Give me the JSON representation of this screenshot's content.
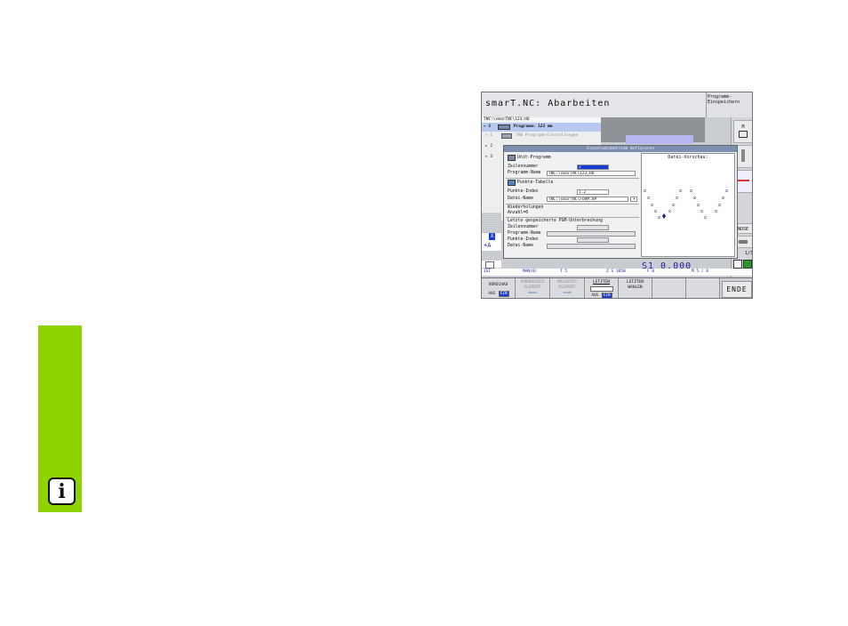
{
  "window": {
    "title": "smarT.NC: Abarbeiten",
    "program_store_label": "Programm-\nEinspeichern",
    "path": "TNC:\\smarTNC\\123.HU"
  },
  "tree": {
    "rows": [
      {
        "prefix": "▾ 0",
        "label": "Programm: 123 mm"
      },
      {
        "prefix": "▸ 1",
        "label": "700 Programm-Einstellungen"
      },
      {
        "prefix": "▸ 2",
        "label": ""
      },
      {
        "prefix": "▸ 3",
        "label": ""
      }
    ]
  },
  "dialog": {
    "title": "Einzelsatzbetrieb definieren",
    "unit_program_header": "Unit-Programm",
    "zeilennummer_label": "Zeilennummer",
    "zeilennummer_value": "2",
    "programm_name_label": "Programm-Name",
    "programm_name_value": "TNC:\\smarTNC\\123.HU",
    "punkte_tabelle_header": "Punkte-Tabelle",
    "punkte_index_label": "Punkte-Index",
    "punkte_index_value": "1.2",
    "datei_name_label": "Datei-Name",
    "datei_name_value": "TNC:\\smarTNC\\FORM.HP",
    "wiederholungen_label": "Wiederholungen",
    "wiederholungen_value": "Anzahl=0",
    "last_saved_header": "Letzte gespeicherte PGM-Unterbrechung",
    "last_zeilennummer_label": "Zeilennummer",
    "last_programm_name_label": "Programm-Name",
    "last_punkte_index_label": "Punkte-Index",
    "last_datei_name_label": "Datei-Name",
    "preview_title": "Datei-Vorschau:"
  },
  "status": {
    "s1_value": "S1   0.000",
    "ist": "IST",
    "mode": "MAN(0)",
    "t_value": "T 5",
    "z_value": "Z S 1050",
    "f_value": "F 0",
    "m_value": "M 5 / 8",
    "page": "1/3"
  },
  "softkeys": [
    {
      "label": "VORSCHAU",
      "sub": [
        "AUS",
        "EIN"
      ],
      "active_sub": 1,
      "dim": false
    },
    {
      "label": "VORHERIGES\nELEMENT",
      "dim": true
    },
    {
      "label": "NACHSTES\nELEMENT",
      "dim": true
    },
    {
      "label": "LETZTEN",
      "sub": [
        "AUS",
        "EIN"
      ],
      "active_sub": 1,
      "dim": false
    },
    {
      "label": "LETZTEN\nWAHLEN",
      "dim": false
    },
    {
      "label": "",
      "dim": false
    },
    {
      "label": "",
      "dim": false
    }
  ],
  "ende_label": "ENDE",
  "right_panel": {
    "nose_label": "NOSE"
  },
  "left_axis": {
    "x_label": "X",
    "a_label": "+A"
  },
  "info_icon_glyph": "i",
  "colors": {
    "sidebar_green": "#8fd400",
    "highlight_blue": "#1a3bd1",
    "status_text": "#1a1aa0"
  }
}
